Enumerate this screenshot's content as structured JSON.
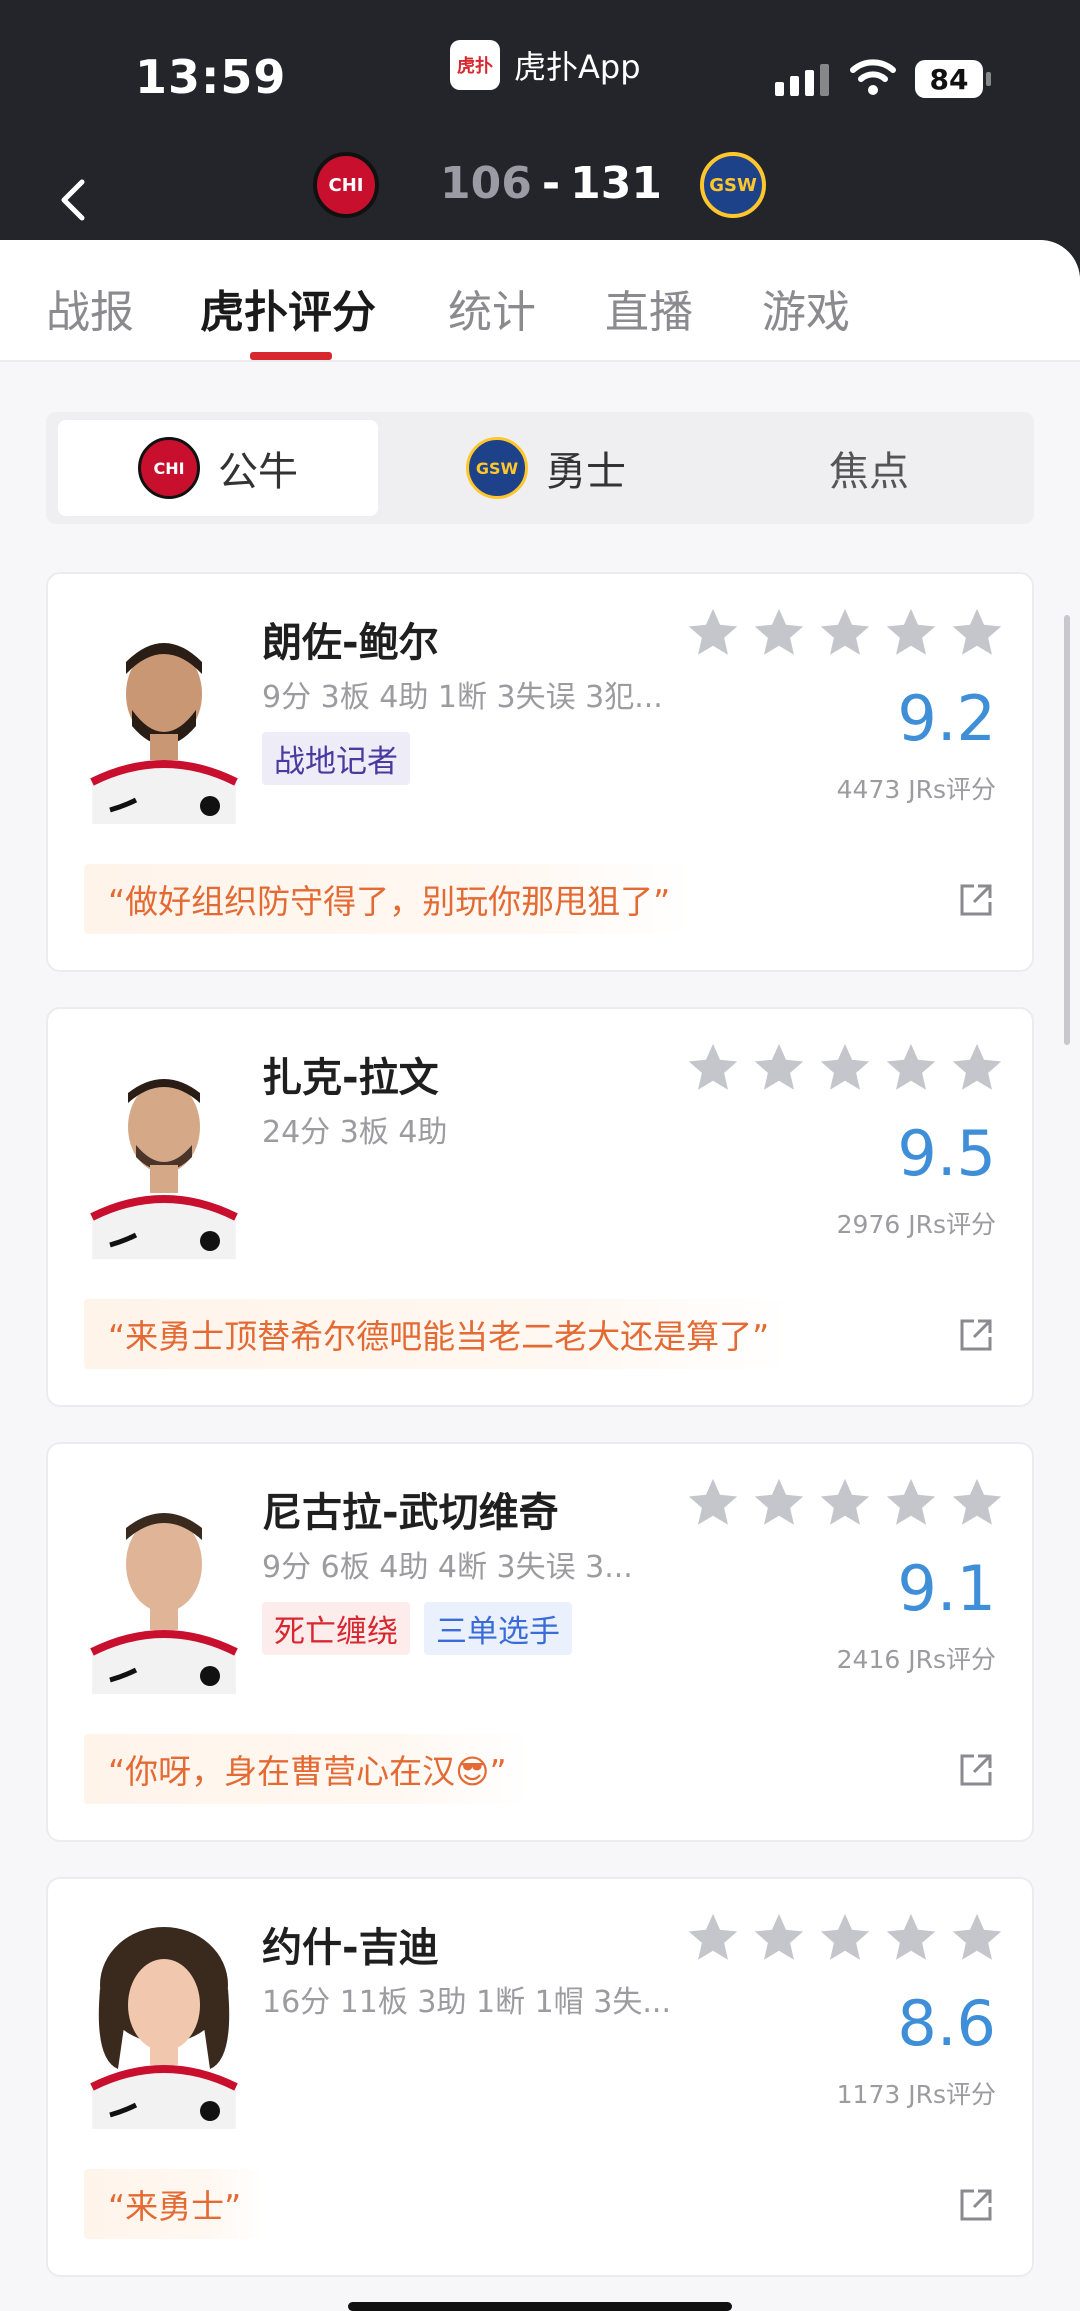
{
  "status_bar": {
    "time": "13:59",
    "app_logo_glyph": "虎扑",
    "app_name": "虎扑App",
    "battery": "84"
  },
  "game": {
    "home_team_logo": "CHI",
    "away_team_logo": "GSW",
    "home_score": "106",
    "separator": "-",
    "away_score": "131"
  },
  "tabs": [
    {
      "label": "战报",
      "active": false
    },
    {
      "label": "虎扑评分",
      "active": true
    },
    {
      "label": "统计",
      "active": false
    },
    {
      "label": "直播",
      "active": false
    },
    {
      "label": "游戏",
      "active": false
    }
  ],
  "segments": [
    {
      "label": "公牛",
      "icon": "CHI",
      "active": true
    },
    {
      "label": "勇士",
      "icon": "GSW",
      "active": false
    },
    {
      "label": "焦点",
      "active": false
    }
  ],
  "players": [
    {
      "name": "朗佐-鲍尔",
      "stats": "9分 3板 4助 1断 3失误 3犯...",
      "tags": [
        {
          "label": "战地记者",
          "color": "#4a3aa0",
          "bg": "#eeecf7"
        }
      ],
      "stars": 5,
      "rating": "9.2",
      "count": "4473 JRs评分",
      "quote": "“做好组织防守得了，别玩你那甩狙了”"
    },
    {
      "name": "扎克-拉文",
      "stats": "24分 3板 4助",
      "tags": [],
      "stars": 5,
      "rating": "9.5",
      "count": "2976 JRs评分",
      "quote": "“来勇士顶替希尔德吧能当老二老大还是算了”"
    },
    {
      "name": "尼古拉-武切维奇",
      "stats": "9分 6板 4助 4断 3失误 3...",
      "tags": [
        {
          "label": "死亡缠绕",
          "color": "#d8282f",
          "bg": "#fdecec"
        },
        {
          "label": "三单选手",
          "color": "#3a6cd8",
          "bg": "#ebf1fc"
        }
      ],
      "stars": 5,
      "rating": "9.1",
      "count": "2416 JRs评分",
      "quote": "“你呀，身在曹营心在汉😎”"
    },
    {
      "name": "约什-吉迪",
      "stats": "16分 11板 3助 1断 1帽 3失...",
      "tags": [],
      "stars": 5,
      "rating": "8.6",
      "count": "1173 JRs评分",
      "quote": "“来勇士”"
    }
  ],
  "colors": {
    "accent_red": "#d8282f",
    "rating_blue": "#3e8ed8",
    "quote_orange": "#e46a34",
    "star_gray": "#c5c6cc"
  }
}
